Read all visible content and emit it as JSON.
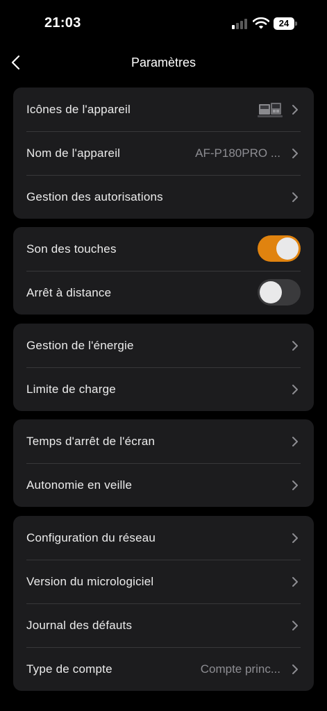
{
  "status_bar": {
    "time": "21:03",
    "battery": "24"
  },
  "nav": {
    "title": "Paramètres"
  },
  "groups": {
    "device": {
      "icon_label": "Icônes de l'appareil",
      "name_label": "Nom de l'appareil",
      "name_value": "AF-P180PRO ...",
      "permissions_label": "Gestion des autorisations"
    },
    "sound": {
      "key_sound_label": "Son des touches",
      "key_sound_on": true,
      "remote_off_label": "Arrêt à distance",
      "remote_off_on": false
    },
    "power": {
      "energy_label": "Gestion de l'énergie",
      "charge_limit_label": "Limite de charge"
    },
    "screen": {
      "screen_timeout_label": "Temps d'arrêt de l'écran",
      "standby_label": "Autonomie en veille"
    },
    "system": {
      "network_label": "Configuration du réseau",
      "firmware_label": "Version du micrologiciel",
      "fault_log_label": "Journal des défauts",
      "account_label": "Type de compte",
      "account_value": "Compte princ..."
    }
  },
  "colors": {
    "accent": "#e0830f",
    "card": "#1c1c1e",
    "background": "#000000"
  }
}
